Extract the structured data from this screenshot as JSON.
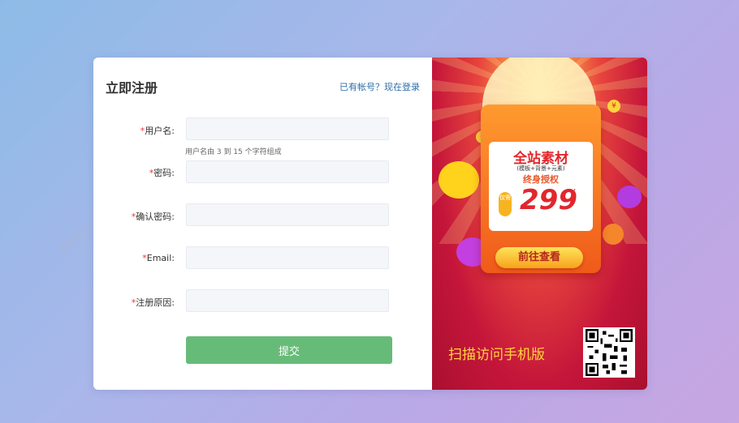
{
  "form": {
    "title": "立即注册",
    "login_link": "已有帐号？现在登录",
    "fields": [
      {
        "label": "用户名:",
        "value": "",
        "placeholder": ""
      },
      {
        "label": "密码:",
        "value": "",
        "placeholder": ""
      },
      {
        "label": "确认密码:",
        "value": "",
        "placeholder": ""
      },
      {
        "label": "Email:",
        "value": "",
        "placeholder": ""
      },
      {
        "label": "注册原因:",
        "value": "",
        "placeholder": ""
      }
    ],
    "required_mark": "*",
    "username_hint": "用户名由 3 到 15 个字符组成",
    "submit_label": "提交"
  },
  "promo": {
    "headline": "全站素材",
    "subline": "(模板+背景+元素)",
    "license": "终身授权",
    "price": "299",
    "currency": "¥",
    "badge": "仅需",
    "button": "前往查看",
    "scan_text": "扫描访问手机版"
  },
  "colors": {
    "submit": "#67bb78",
    "link": "#2d6ea8",
    "required": "#ee3333"
  }
}
